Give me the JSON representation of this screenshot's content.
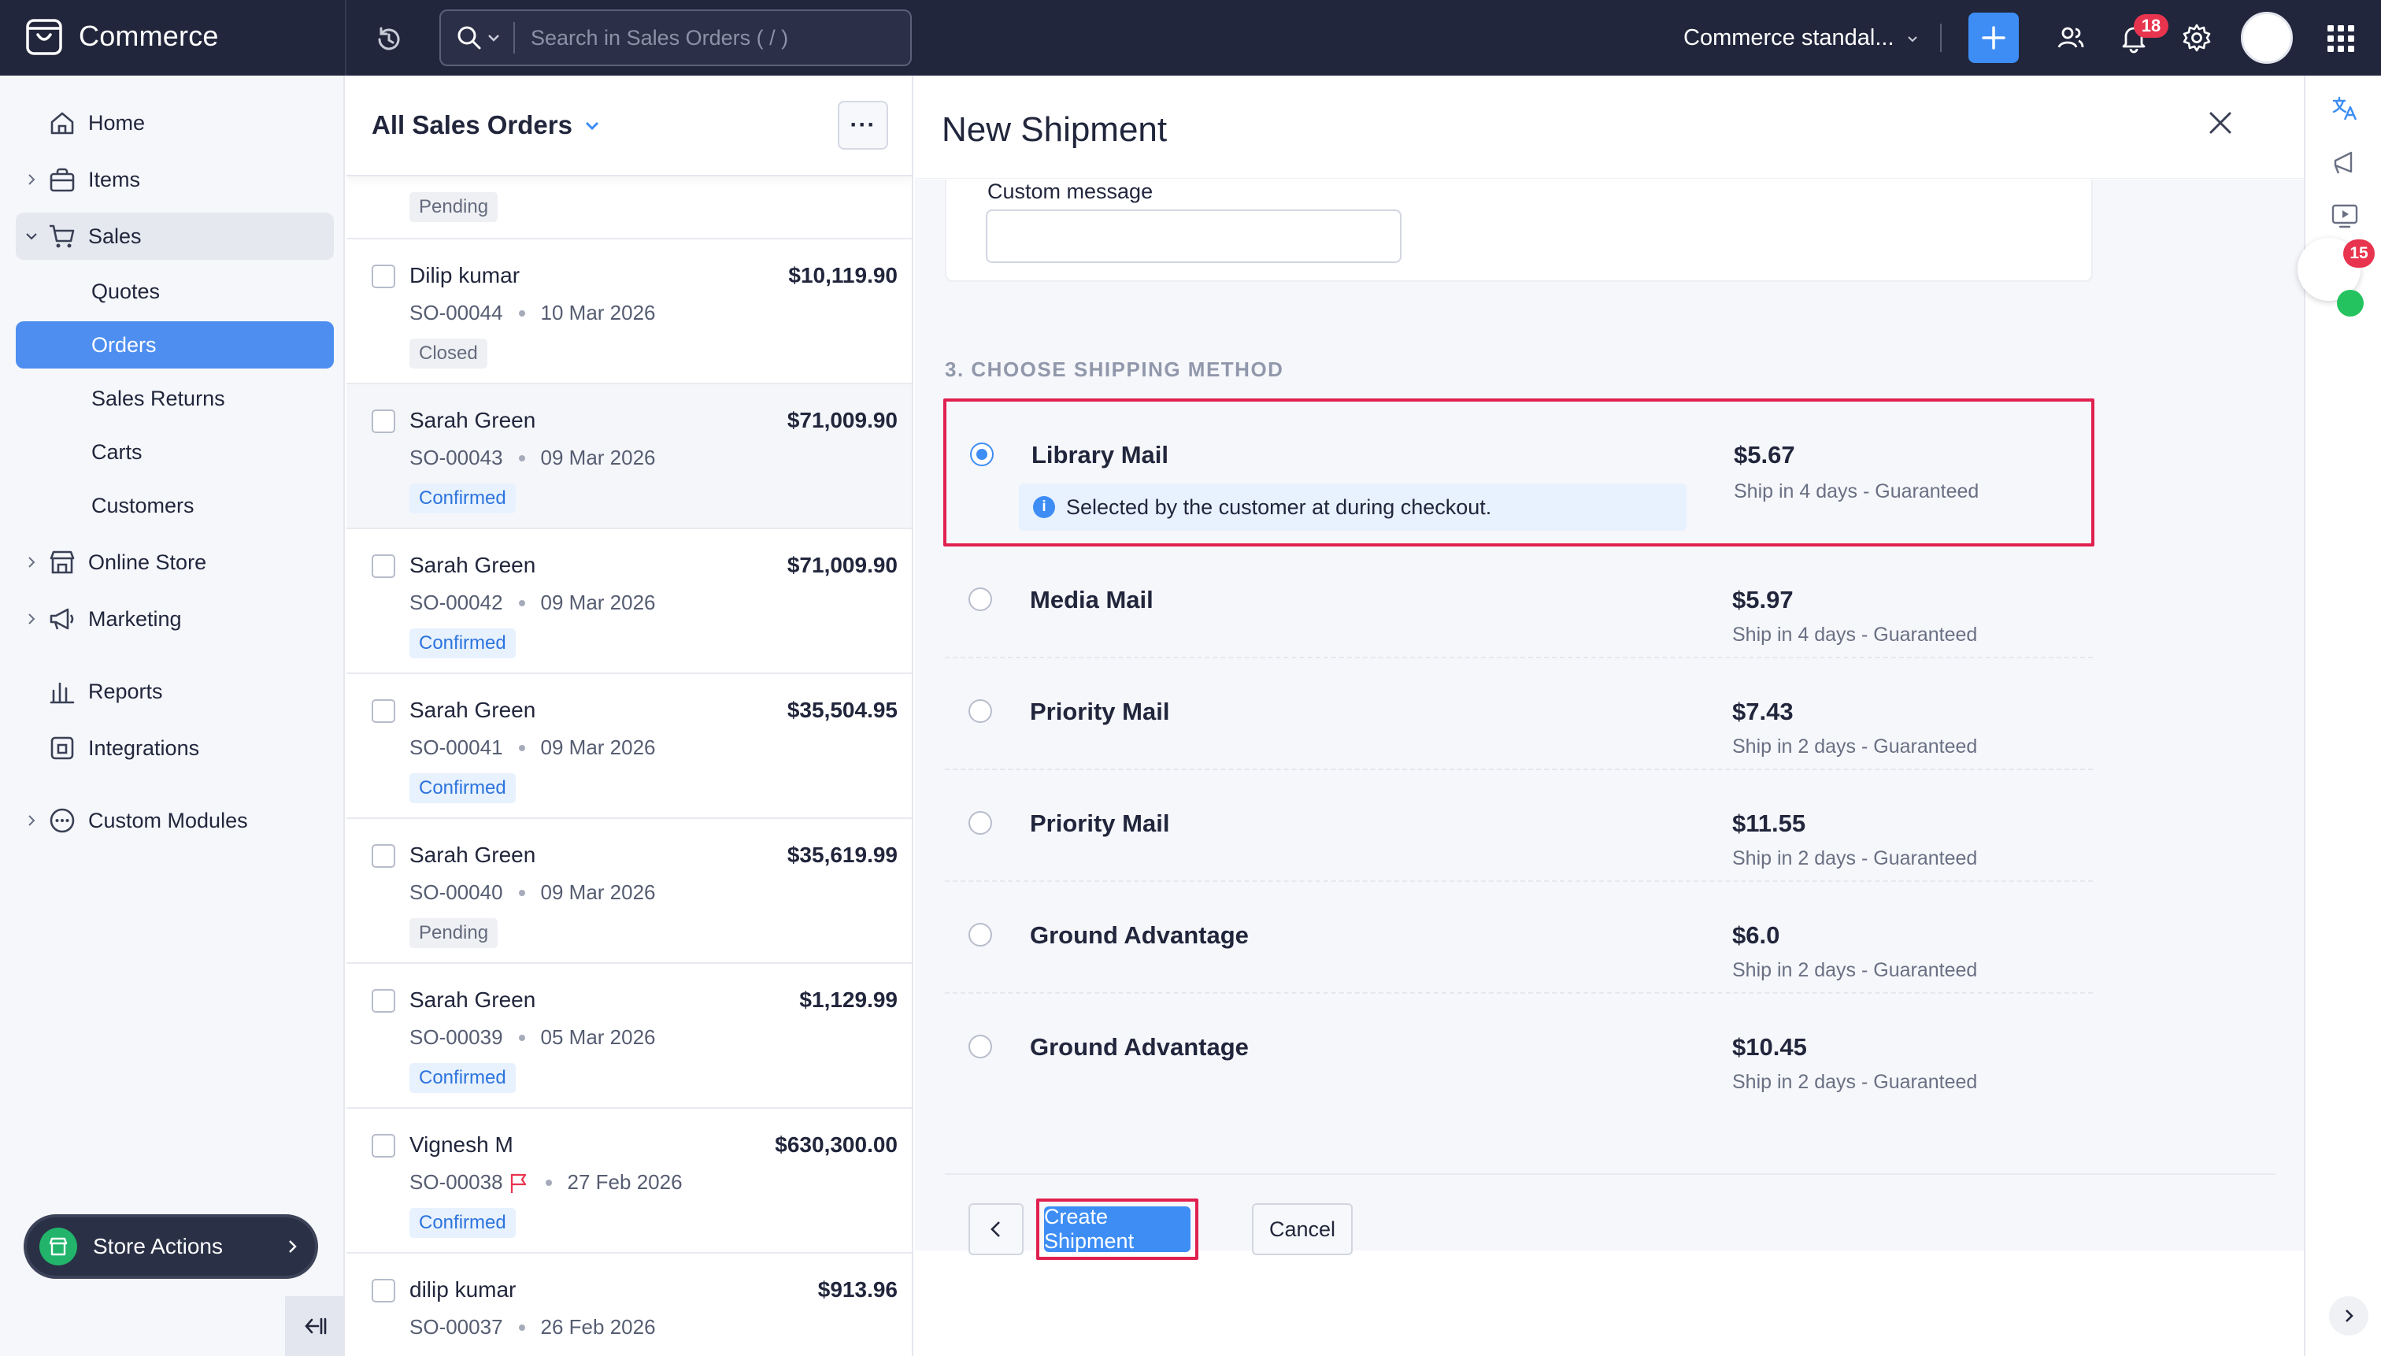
{
  "app": {
    "name": "Commerce"
  },
  "topbar": {
    "search_placeholder": "Search in Sales Orders ( / )",
    "org_name": "Commerce standal...",
    "notifications_count": "18",
    "colors": {
      "bg": "#21263c",
      "accent": "#3d8df5",
      "badge": "#e8344e"
    }
  },
  "sidebar": {
    "items": [
      {
        "label": "Home",
        "icon": "home-icon"
      },
      {
        "label": "Items",
        "icon": "bag-icon"
      },
      {
        "label": "Sales",
        "icon": "cart-icon"
      },
      {
        "label": "Quotes"
      },
      {
        "label": "Orders"
      },
      {
        "label": "Sales Returns"
      },
      {
        "label": "Carts"
      },
      {
        "label": "Customers"
      },
      {
        "label": "Online Store",
        "icon": "store-icon"
      },
      {
        "label": "Marketing",
        "icon": "megaphone-icon"
      },
      {
        "label": "Reports",
        "icon": "bar-chart-icon"
      },
      {
        "label": "Integrations",
        "icon": "puzzle-icon"
      },
      {
        "label": "Custom Modules",
        "icon": "more-circle-icon"
      }
    ],
    "store_actions_label": "Store Actions"
  },
  "orders": {
    "title": "All Sales Orders",
    "top_partial_status": "Pending",
    "rows": [
      {
        "customer": "Dilip kumar",
        "amount": "$10,119.90",
        "number": "SO-00044",
        "date": "10 Mar 2026",
        "status": "Closed"
      },
      {
        "customer": "Sarah Green",
        "amount": "$71,009.90",
        "number": "SO-00043",
        "date": "09 Mar 2026",
        "status": "Confirmed"
      },
      {
        "customer": "Sarah Green",
        "amount": "$71,009.90",
        "number": "SO-00042",
        "date": "09 Mar 2026",
        "status": "Confirmed"
      },
      {
        "customer": "Sarah Green",
        "amount": "$35,504.95",
        "number": "SO-00041",
        "date": "09 Mar 2026",
        "status": "Confirmed"
      },
      {
        "customer": "Sarah Green",
        "amount": "$35,619.99",
        "number": "SO-00040",
        "date": "09 Mar 2026",
        "status": "Pending"
      },
      {
        "customer": "Sarah Green",
        "amount": "$1,129.99",
        "number": "SO-00039",
        "date": "05 Mar 2026",
        "status": "Confirmed"
      },
      {
        "customer": "Vignesh M",
        "amount": "$630,300.00",
        "number": "SO-00038",
        "date": "27 Feb 2026",
        "status": "Confirmed"
      },
      {
        "customer": "dilip kumar",
        "amount": "$913.96",
        "number": "SO-00037",
        "date": "26 Feb 2026",
        "status": ""
      }
    ]
  },
  "shipment": {
    "title": "New Shipment",
    "custom_message_label": "Custom message",
    "custom_message_value": "",
    "section_title": "3. CHOOSE SHIPPING METHOD",
    "methods": [
      {
        "name": "Library Mail",
        "price": "$5.67",
        "eta": "Ship in 4 days - Guaranteed",
        "selected": true,
        "note": "Selected by the customer at during checkout."
      },
      {
        "name": "Media Mail",
        "price": "$5.97",
        "eta": "Ship in 4 days - Guaranteed"
      },
      {
        "name": "Priority Mail",
        "price": "$7.43",
        "eta": "Ship in 2 days - Guaranteed"
      },
      {
        "name": "Priority Mail",
        "price": "$11.55",
        "eta": "Ship in 2 days - Guaranteed"
      },
      {
        "name": "Ground Advantage",
        "price": "$6.0",
        "eta": "Ship in 2 days - Guaranteed"
      },
      {
        "name": "Ground Advantage",
        "price": "$10.45",
        "eta": "Ship in 2 days - Guaranteed"
      }
    ],
    "create_label": "Create Shipment",
    "cancel_label": "Cancel"
  },
  "rail": {
    "chat_badge": "15"
  }
}
